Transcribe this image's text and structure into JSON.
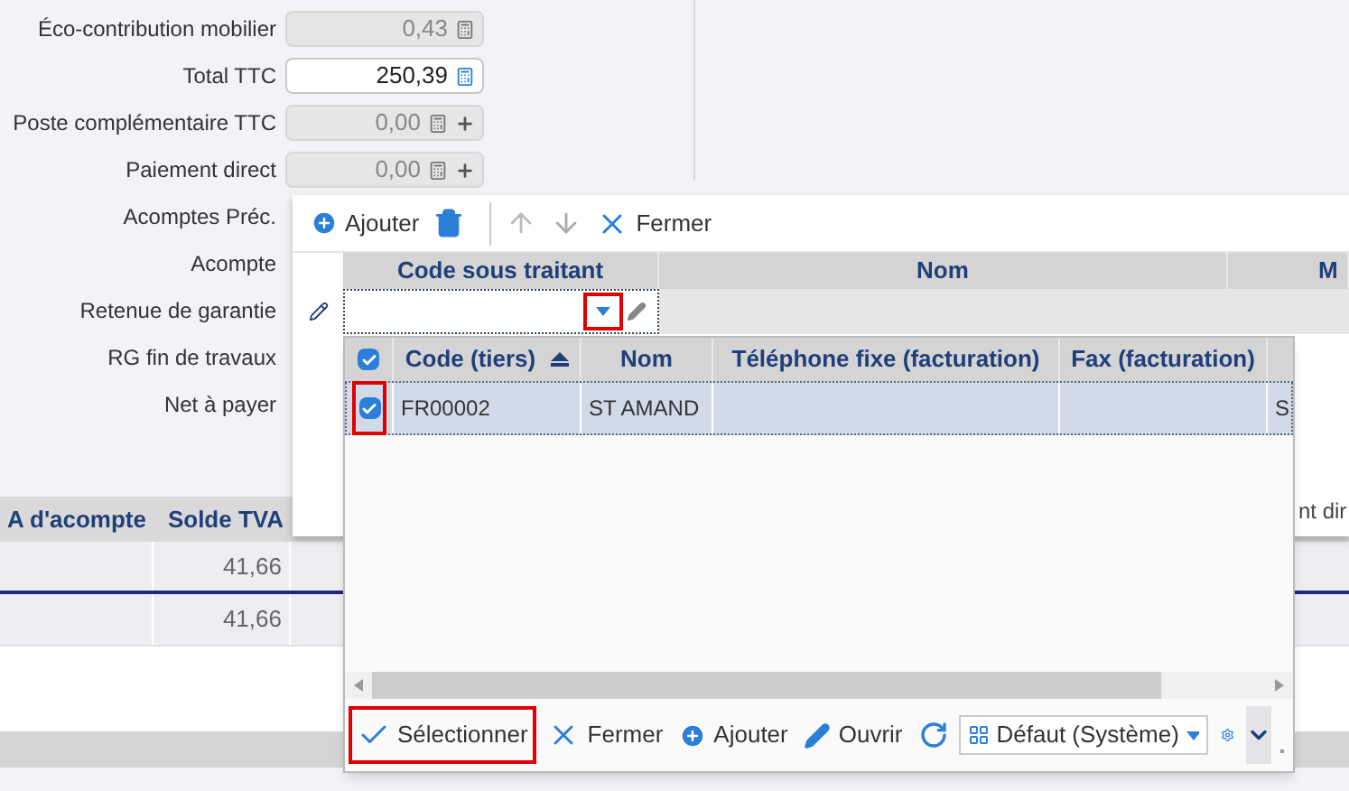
{
  "form": {
    "rows": [
      {
        "label": "Éco-contribution mobilier",
        "kind": "calc",
        "value": "0,43",
        "editable": false
      },
      {
        "label": "Total TTC",
        "kind": "calc",
        "value": "250,39",
        "editable": true
      },
      {
        "label": "Poste complémentaire TTC",
        "kind": "calc_plus",
        "value": "0,00",
        "editable": false
      },
      {
        "label": "Paiement direct",
        "kind": "calc_plus",
        "value": "0,00",
        "editable": false
      },
      {
        "label": "Acomptes Préc.",
        "kind": "label"
      },
      {
        "label": "Acompte",
        "kind": "label"
      },
      {
        "label": "Retenue de garantie",
        "kind": "label"
      },
      {
        "label": "RG fin de travaux",
        "kind": "label"
      },
      {
        "label": "Net à payer",
        "kind": "label"
      }
    ]
  },
  "background_grid": {
    "columns": [
      "A d'acompte",
      "Solde TVA"
    ],
    "rows": [
      [
        "",
        "41,66"
      ],
      [
        "",
        "41,66"
      ]
    ]
  },
  "panel": {
    "toolbar": [
      {
        "kind": "add",
        "label": "Ajouter"
      },
      {
        "kind": "delete"
      },
      {
        "kind": "up"
      },
      {
        "kind": "down"
      },
      {
        "kind": "close",
        "label": "Fermer"
      }
    ],
    "columns": [
      "Code sous traitant",
      "Nom",
      "M"
    ],
    "dropdown_highlighted": true,
    "side_text": "nt dir"
  },
  "popup": {
    "header_checked": true,
    "columns": [
      {
        "label": "Code (tiers)",
        "sorted": true
      },
      {
        "label": "Nom",
        "sorted": false
      },
      {
        "label": "Téléphone fixe (facturation)",
        "sorted": false
      },
      {
        "label": "Fax (facturation)",
        "sorted": false
      }
    ],
    "rows": [
      {
        "selected": true,
        "checked": true,
        "highlighted": true,
        "cells": [
          "FR00002",
          "ST AMAND",
          "",
          "",
          "S"
        ]
      }
    ],
    "toolbar": [
      {
        "kind": "select",
        "label": "Sélectionner",
        "highlighted": true
      },
      {
        "kind": "close",
        "label": "Fermer",
        "highlighted": false
      },
      {
        "kind": "add",
        "label": "Ajouter",
        "highlighted": false
      },
      {
        "kind": "open",
        "label": "Ouvrir",
        "highlighted": false
      },
      {
        "kind": "refresh",
        "highlighted": false
      }
    ],
    "view_select": {
      "value": "Défaut (Système)"
    }
  }
}
